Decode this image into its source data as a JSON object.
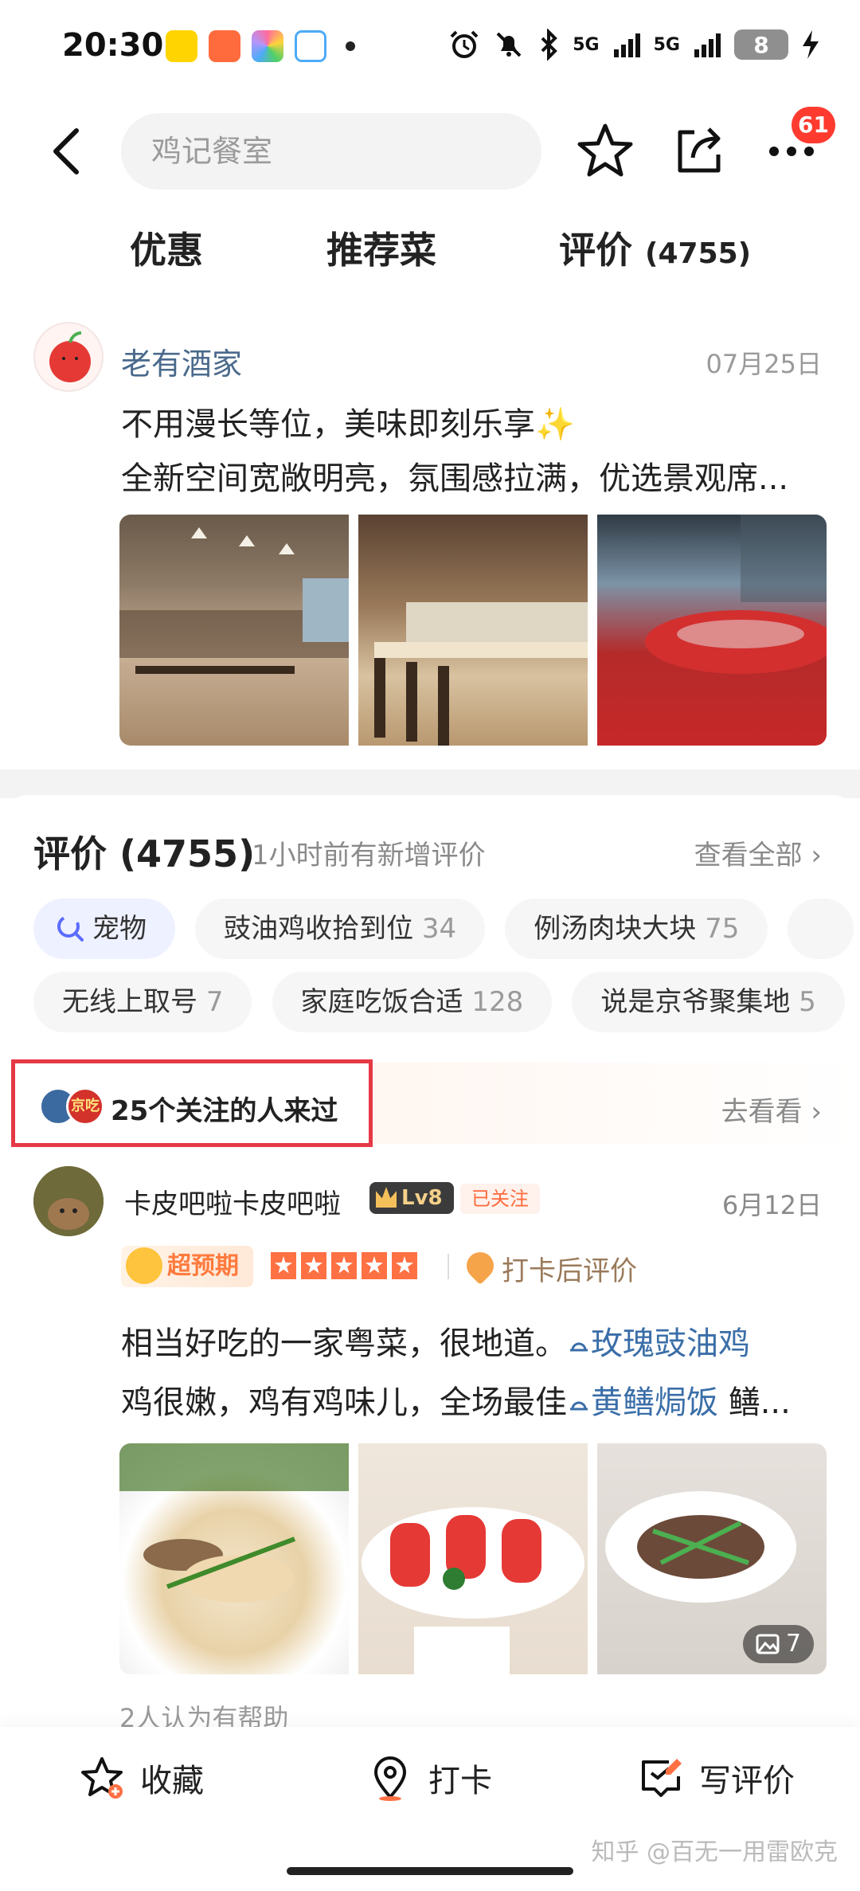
{
  "status": {
    "time": "20:30",
    "network1": "5G",
    "network2": "5G",
    "battery": "8"
  },
  "nav": {
    "search_text": "鸡记餐室",
    "badge": "61"
  },
  "tabs": {
    "offers": "优惠",
    "recommended": "推荐菜",
    "reviews": "评价",
    "reviews_count": "(4755)"
  },
  "post": {
    "name": "老有酒家",
    "date": "07月25日",
    "line1": "不用漫长等位，美味即刻乐享✨",
    "line2": "全新空间宽敞明亮，氛围感拉满，优选景观席..."
  },
  "reviews": {
    "title": "评价 (4755)",
    "subtitle": "1小时前有新增评价",
    "view_all": "查看全部 ›",
    "chips_row1": [
      {
        "label": "宠物",
        "count": ""
      },
      {
        "label": "豉油鸡收拾到位",
        "count": "34"
      },
      {
        "label": "例汤肉块大块",
        "count": "75"
      }
    ],
    "chips_row2": [
      {
        "label": "无线上取号",
        "count": "7"
      },
      {
        "label": "家庭吃饭合适",
        "count": "128"
      },
      {
        "label": "说是京爷聚集地",
        "count": "5"
      }
    ],
    "friends_text": "25个关注的人来过",
    "friends_avatar2": "京吃",
    "go_see": "去看看 ›"
  },
  "review_item": {
    "user": "卡皮吧啦卡皮吧啦",
    "level": "Lv8",
    "followed": "已关注",
    "date": "6月12日",
    "exceed": "超预期",
    "rating": 5,
    "checkin": "打卡后评价",
    "line1_text": "相当好吃的一家粤菜，很地道。",
    "line1_dish": "玫瑰豉油鸡",
    "line2_text": "鸡很嫩，鸡有鸡味儿，全场最佳",
    "line2_dish": "黄鳝焗饭",
    "line2_tail": " 鳝...",
    "photo_count": "7",
    "helpful": "2人认为有帮助"
  },
  "bottom": {
    "favorite": "收藏",
    "checkin": "打卡",
    "write_review": "写评价"
  },
  "watermark": "知乎 @百无一用雷欧克"
}
